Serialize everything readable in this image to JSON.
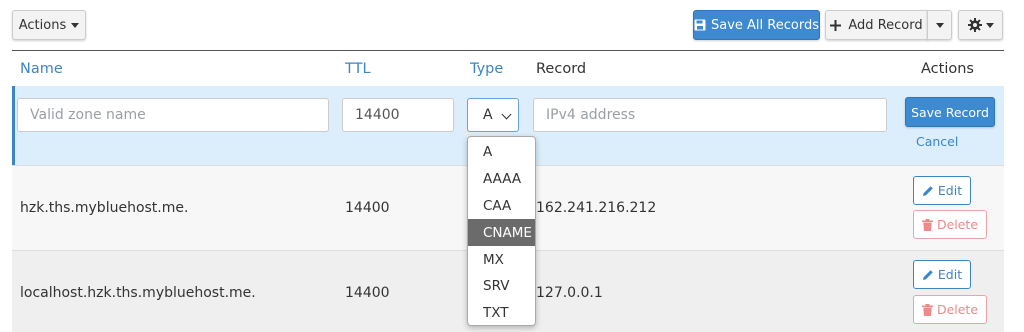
{
  "toolbar": {
    "actions_label": "Actions",
    "save_all_label": "Save All Records",
    "add_record_label": "Add Record"
  },
  "columns": {
    "name": "Name",
    "ttl": "TTL",
    "type": "Type",
    "record": "Record",
    "actions": "Actions"
  },
  "edit_row": {
    "name_placeholder": "Valid zone name",
    "ttl_value": "14400",
    "type_value": "A",
    "record_placeholder": "IPv4 address",
    "save_label": "Save Record",
    "cancel_label": "Cancel"
  },
  "type_options": [
    "A",
    "AAAA",
    "CAA",
    "CNAME",
    "MX",
    "SRV",
    "TXT"
  ],
  "type_highlighted": "CNAME",
  "rows": [
    {
      "name": "hzk.ths.mybluehost.me.",
      "ttl": "14400",
      "record": "162.241.216.212",
      "edit_label": "Edit",
      "delete_label": "Delete"
    },
    {
      "name": "localhost.hzk.ths.mybluehost.me.",
      "ttl": "14400",
      "record": "127.0.0.1",
      "edit_label": "Edit",
      "delete_label": "Delete"
    }
  ],
  "colors": {
    "primary": "#3e8ad1",
    "link": "#3d86c6",
    "edit_row_bg": "#dceefb",
    "delete": "#ee8a8a"
  },
  "icons": {
    "save_all": "floppy-disk-icon",
    "add": "plus-icon",
    "settings": "gear-icon",
    "edit": "pencil-icon",
    "delete": "trash-icon"
  }
}
